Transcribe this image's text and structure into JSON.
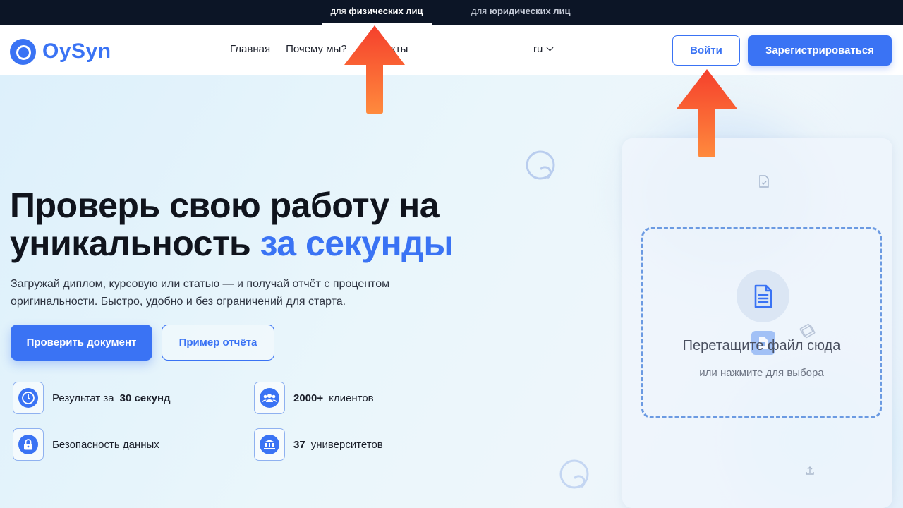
{
  "topbar": {
    "personal_prefix": "для",
    "personal_bold": "физических лиц",
    "business_prefix": "для",
    "business_bold": "юридических лиц"
  },
  "nav": {
    "logo_text": "OySyn",
    "links": [
      "Главная",
      "Почему мы?",
      "Контакты"
    ],
    "lang": "ru",
    "login": "Войти",
    "register": "Зарегистрироваться"
  },
  "hero": {
    "title_line1": "Проверь свою работу на",
    "title_line2_plain": "уникальность",
    "title_line2_accent": "за секунды",
    "subtitle": "Загружай диплом, курсовую или статью — и получай отчёт с процентом оригинальности. Быстро, удобно и без ограничений для старта.",
    "primary_button": "Проверить документ",
    "secondary_button": "Пример отчёта"
  },
  "features": [
    {
      "icon": "clock-icon",
      "text": "Результат за",
      "bold": "30 секунд",
      "after": ""
    },
    {
      "icon": "users-icon",
      "text": "",
      "bold": "2000+",
      "after": "клиентов"
    },
    {
      "icon": "lock-icon",
      "text": "Безопасность данных",
      "bold": "",
      "after": ""
    },
    {
      "icon": "university-icon",
      "text": "",
      "bold": "37",
      "after": "университетов"
    }
  ],
  "upload": {
    "title": "Перетащите файл сюда",
    "hint": "или нажмите для выбора"
  },
  "colors": {
    "accent": "#3a73f4",
    "topbar": "#0c1526",
    "arrow_top": "#f5402c",
    "arrow_bottom": "#ff8a3d"
  }
}
